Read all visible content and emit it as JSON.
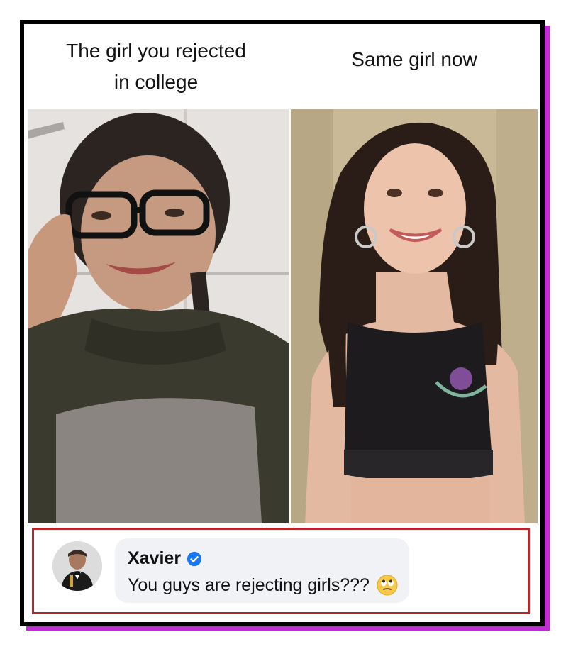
{
  "meme": {
    "left_caption_line1": "The girl you rejected",
    "left_caption_line2": "in college",
    "right_caption": "Same girl now"
  },
  "comment": {
    "author": "Xavier",
    "text": "You guys are rejecting girls???",
    "verified_icon": "verified-badge-icon",
    "emoji_icon": "eye-roll-emoji-icon"
  },
  "colors": {
    "frame_border": "#000000",
    "frame_shadow": "#c12bd6",
    "comment_border": "#b3262c",
    "verified_blue": "#1877f2",
    "bubble_bg": "#f0f2f5"
  }
}
